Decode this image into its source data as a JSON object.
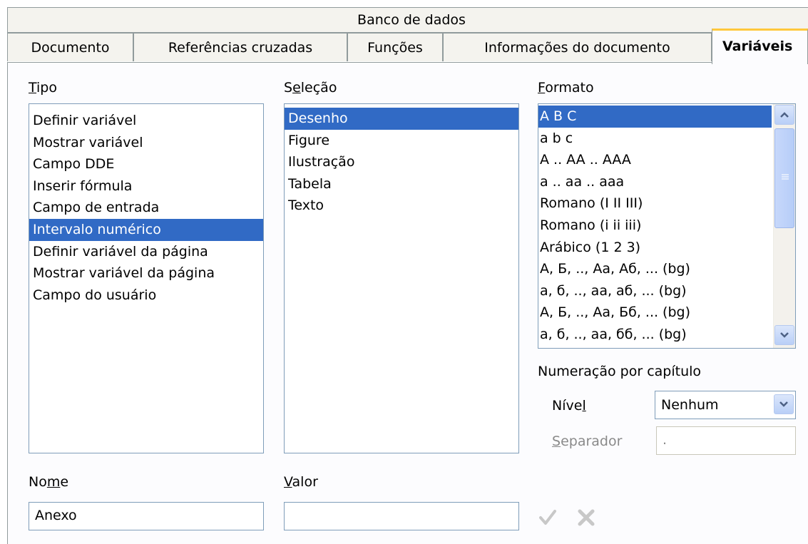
{
  "tabs": {
    "row1": [
      "Banco de dados"
    ],
    "row2": [
      "Documento",
      "Referências cruzadas",
      "Funções",
      "Informações do documento",
      "Variáveis"
    ]
  },
  "tipo": {
    "label": "Tipo",
    "items": [
      "Definir variável",
      "Mostrar variável",
      "Campo DDE",
      "Inserir fórmula",
      "Campo de entrada",
      "Intervalo numérico",
      "Definir variável da página",
      "Mostrar variável da página",
      "Campo do usuário"
    ],
    "selected": "Intervalo numérico"
  },
  "selecao": {
    "label": "Seleção",
    "items": [
      "Desenho",
      "Figure",
      "Ilustração",
      "Tabela",
      "Texto"
    ],
    "selected": "Desenho"
  },
  "formato": {
    "label": "Formato",
    "items": [
      "A B C",
      "a b c",
      "A .. AA .. AAA",
      "a .. aa .. aaa",
      "Romano (I II III)",
      "Romano (i ii iii)",
      "Arábico (1 2 3)",
      "А, Б, .., Аа, Аб, ... (bg)",
      "а, б, .., аа, аб, ... (bg)",
      "А, Б, .., Аа, Бб, ... (bg)",
      "а, б, .., аа, бб, ... (bg)"
    ],
    "selected": "A B C"
  },
  "numeracao": {
    "label": "Numeração por capítulo",
    "nivel_label": "Nível",
    "nivel_value": "Nenhum",
    "separador_label": "Separador",
    "separador_value": "."
  },
  "nome": {
    "label": "Nome",
    "value": "Anexo"
  },
  "valor": {
    "label": "Valor",
    "value": ""
  },
  "icons": {
    "apply": "check-icon",
    "delete": "x-icon"
  },
  "colors": {
    "selection": "#316ac5",
    "active_tab": "#ffc83c",
    "border": "#7f9db9"
  }
}
